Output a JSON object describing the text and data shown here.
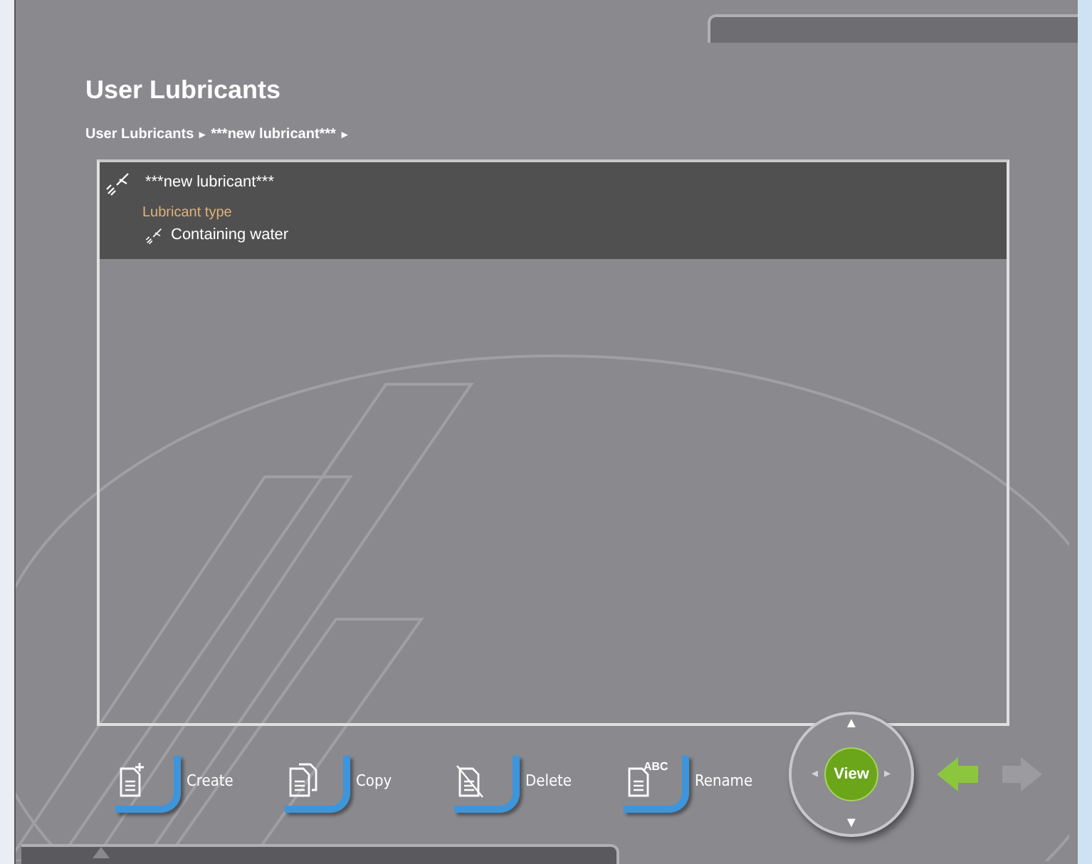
{
  "title": "User Lubricants",
  "breadcrumb": [
    {
      "label": "User Lubricants",
      "separator": "▸"
    },
    {
      "label": "***new lubricant***",
      "separator": "▸"
    }
  ],
  "list": {
    "items": [
      {
        "name": "***new lubricant***",
        "selected": true,
        "property_label": "Lubricant type",
        "property_value": "Containing water"
      }
    ]
  },
  "actions": [
    {
      "kind": "create",
      "label": "Create"
    },
    {
      "kind": "copy",
      "label": "Copy"
    },
    {
      "kind": "delete",
      "label": "Delete"
    },
    {
      "kind": "rename",
      "label": "Rename",
      "icon_text": "ABC"
    }
  ],
  "navigator": {
    "center_label": "View",
    "up": "▲",
    "down": "▼",
    "left": "◂",
    "right": "▸"
  },
  "back_arrow": {
    "disabled": false
  },
  "forward_arrow": {
    "disabled": true
  }
}
